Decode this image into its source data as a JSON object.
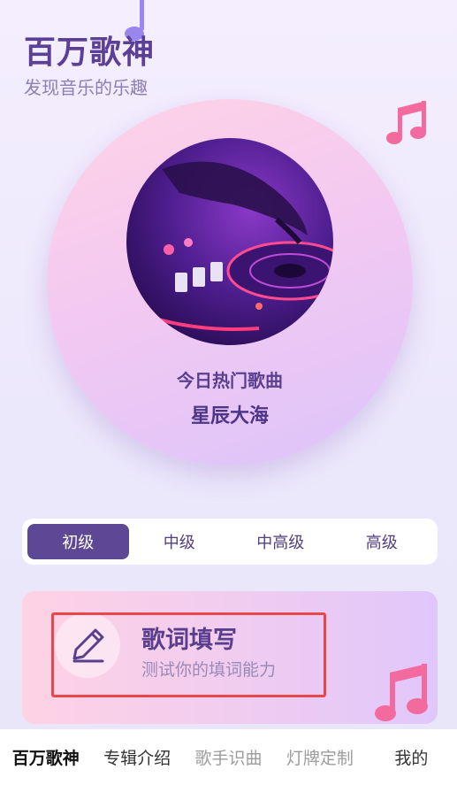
{
  "header": {
    "title": "百万歌神",
    "subtitle": "发现音乐的乐趣"
  },
  "hero": {
    "label": "今日热门歌曲",
    "song": "星辰大海"
  },
  "levels": [
    {
      "label": "初级",
      "active": true
    },
    {
      "label": "中级",
      "active": false
    },
    {
      "label": "中高级",
      "active": false
    },
    {
      "label": "高级",
      "active": false
    }
  ],
  "mode_card": {
    "title": "歌词填写",
    "description": "测试你的填词能力",
    "icon": "pencil-icon"
  },
  "bottom_nav": [
    {
      "label": "百万歌神",
      "active": true
    },
    {
      "label": "专辑介绍",
      "active": false
    },
    {
      "label": "歌手识曲",
      "active": false
    },
    {
      "label": "灯牌定制",
      "active": false
    },
    {
      "label": "我的",
      "active": false
    }
  ],
  "colors": {
    "primary": "#5e4794",
    "accent_pink": "#f06b9a",
    "highlight_red": "#e8474b"
  }
}
